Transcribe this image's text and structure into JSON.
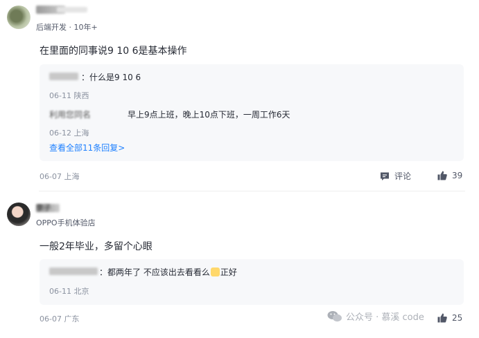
{
  "comments": [
    {
      "meta": "后端开发 · 10年+",
      "content": "在里面的同事说9 10 6是基本操作",
      "replies": [
        {
          "text": "：什么是9 10 6",
          "date": "06-11 陕西"
        },
        {
          "prefix": "利用您同名",
          "text": "早上9点上班，晚上10点下班，一周工作6天",
          "date": "06-12 上海"
        }
      ],
      "view_all": "查看全部11条回复>",
      "date": "06-07 上海",
      "comment_label": "评论",
      "likes": "39"
    },
    {
      "name": "李子",
      "meta": "OPPO手机体验店",
      "content": "一般2年毕业，多留个心眼",
      "reply": {
        "text_before": "：都两年了 不应该出去看看么",
        "text_after": "正好",
        "date": "06-11 北京"
      },
      "date": "06-07 广东",
      "likes": "25"
    }
  ],
  "watermark": {
    "text": "公众号 · 慕溪 code"
  },
  "icons": {
    "comment": "comment-icon",
    "like": "thumbs-up-icon",
    "wechat": "wechat-icon",
    "emoji": "emoji-icon"
  },
  "colors": {
    "link": "#1e80ff",
    "meta": "#8a919f",
    "text": "#252933",
    "reply_bg": "#f7f8fa"
  }
}
